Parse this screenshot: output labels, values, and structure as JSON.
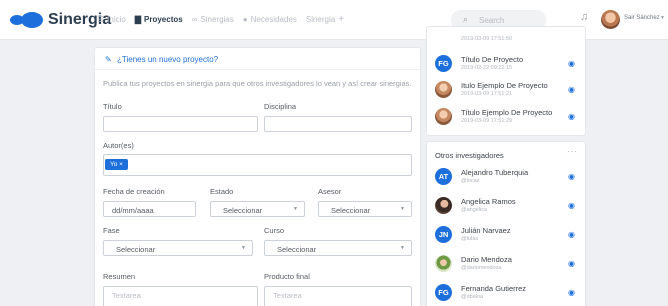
{
  "brand": {
    "name": "Sinergia"
  },
  "nav": {
    "items": [
      {
        "label": "Inicio",
        "icon": "list-icon"
      },
      {
        "label": "Proyectos",
        "icon": "folder-icon",
        "active": true
      },
      {
        "label": "Sinergias",
        "icon": "link-icon"
      },
      {
        "label": "Necesidades",
        "icon": "info-icon"
      },
      {
        "label": "Sinergia",
        "icon": "plus-icon"
      }
    ]
  },
  "search": {
    "placeholder": "Search"
  },
  "user": {
    "name": "Sair Sánchez"
  },
  "form": {
    "title": "¿Tienes un nuevo proyecto?",
    "intro": "Publica tus proyectos en sinergia para que otros investigadores lo vean y así crear sinergias.",
    "titulo_label": "Título",
    "disciplina_label": "Disciplina",
    "autores_label": "Autor(es)",
    "author_tag": "Yo ×",
    "fecha_label": "Fecha de creación",
    "fecha_placeholder": "dd/mm/aaaa",
    "estado_label": "Estado",
    "estado_value": "Seleccionar",
    "asesor_label": "Asesor",
    "asesor_value": "Seleccionar",
    "fase_label": "Fase",
    "fase_value": "Seleccionar",
    "curso_label": "Curso",
    "curso_value": "Seleccionar",
    "resumen_label": "Resumen",
    "resumen_placeholder": "Textarea",
    "producto_label": "Producto final",
    "producto_placeholder": "Textarea"
  },
  "projects": {
    "partial_date": "2019-03-09 17:51:50",
    "items": [
      {
        "title": "Título De Proyecto",
        "date": "2019-02-22 09:22:15",
        "avatar": "FG"
      },
      {
        "title": "Itulo Ejemplo De Proyecto",
        "date": "2019-03-09 17:51:21",
        "avatar": "photo"
      },
      {
        "title": "Título Ejemplo De Proyecto",
        "date": "2019-03-09 17:51:29",
        "avatar": "photo"
      }
    ]
  },
  "researchers": {
    "title": "Otros investigadores",
    "items": [
      {
        "name": "Alejandro Tuberquia",
        "handle": "@locaz",
        "initials": "AT"
      },
      {
        "name": "Angelica Ramos",
        "handle": "@angelica",
        "initials": ""
      },
      {
        "name": "Julián Narvaez",
        "handle": "@fulas",
        "initials": "JN"
      },
      {
        "name": "Dario Mendoza",
        "handle": "@dariomendoza",
        "initials": ""
      },
      {
        "name": "Fernanda Gutierrez",
        "handle": "@dbaloa",
        "initials": "FG"
      }
    ]
  },
  "colors": {
    "accent": "#1d6fdc",
    "background": "#eef0f3"
  }
}
